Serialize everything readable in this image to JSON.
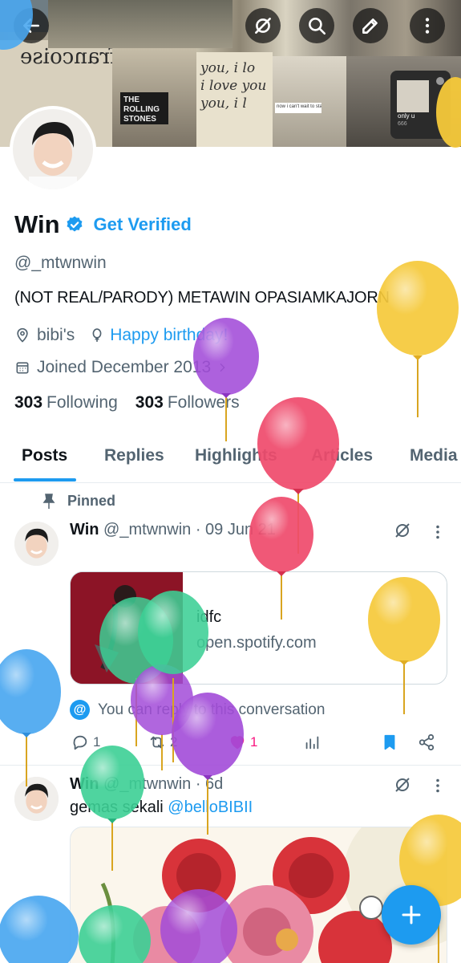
{
  "banner": {
    "texts": [
      "francoise",
      "you, i lo",
      "i love you",
      "you, i l",
      "THE ROLLING STONES",
      "now i can't wait to start",
      "only u",
      "666"
    ]
  },
  "profile": {
    "name": "Win",
    "get_verified": "Get Verified",
    "handle": "@_mtwnwin",
    "bio": "(NOT REAL/PARODY) METAWIN OPASIAMKAJORN",
    "location": "bibi's",
    "birthday": "Happy birthday!",
    "joined": "Joined December 2013",
    "following_count": "303",
    "following_label": "Following",
    "followers_count": "303",
    "followers_label": "Followers"
  },
  "tabs": [
    "Posts",
    "Replies",
    "Highlights",
    "Articles",
    "Media"
  ],
  "pinned_label": "Pinned",
  "post1": {
    "name": "Win",
    "handle": "@_mtwnwin",
    "date": "· 09 Jun 21",
    "card_title": "idfc",
    "card_domain": "open.spotify.com",
    "reply_note": "You can reply to this conversation",
    "replies": "1",
    "reposts": "2",
    "likes": "1"
  },
  "post2": {
    "name": "Win",
    "handle": "@_mtwnwin",
    "time": "· 6d",
    "text": "gemas sekali",
    "mention": "@belloBIBII"
  },
  "colors": {
    "accent": "#1d9bf0",
    "like": "#f91880",
    "balloon_purple": "#a24bd8",
    "balloon_red": "#ef4a6b",
    "balloon_yellow": "#f5c93a",
    "balloon_blue": "#4aa7f0",
    "balloon_green": "#3ccf95"
  }
}
